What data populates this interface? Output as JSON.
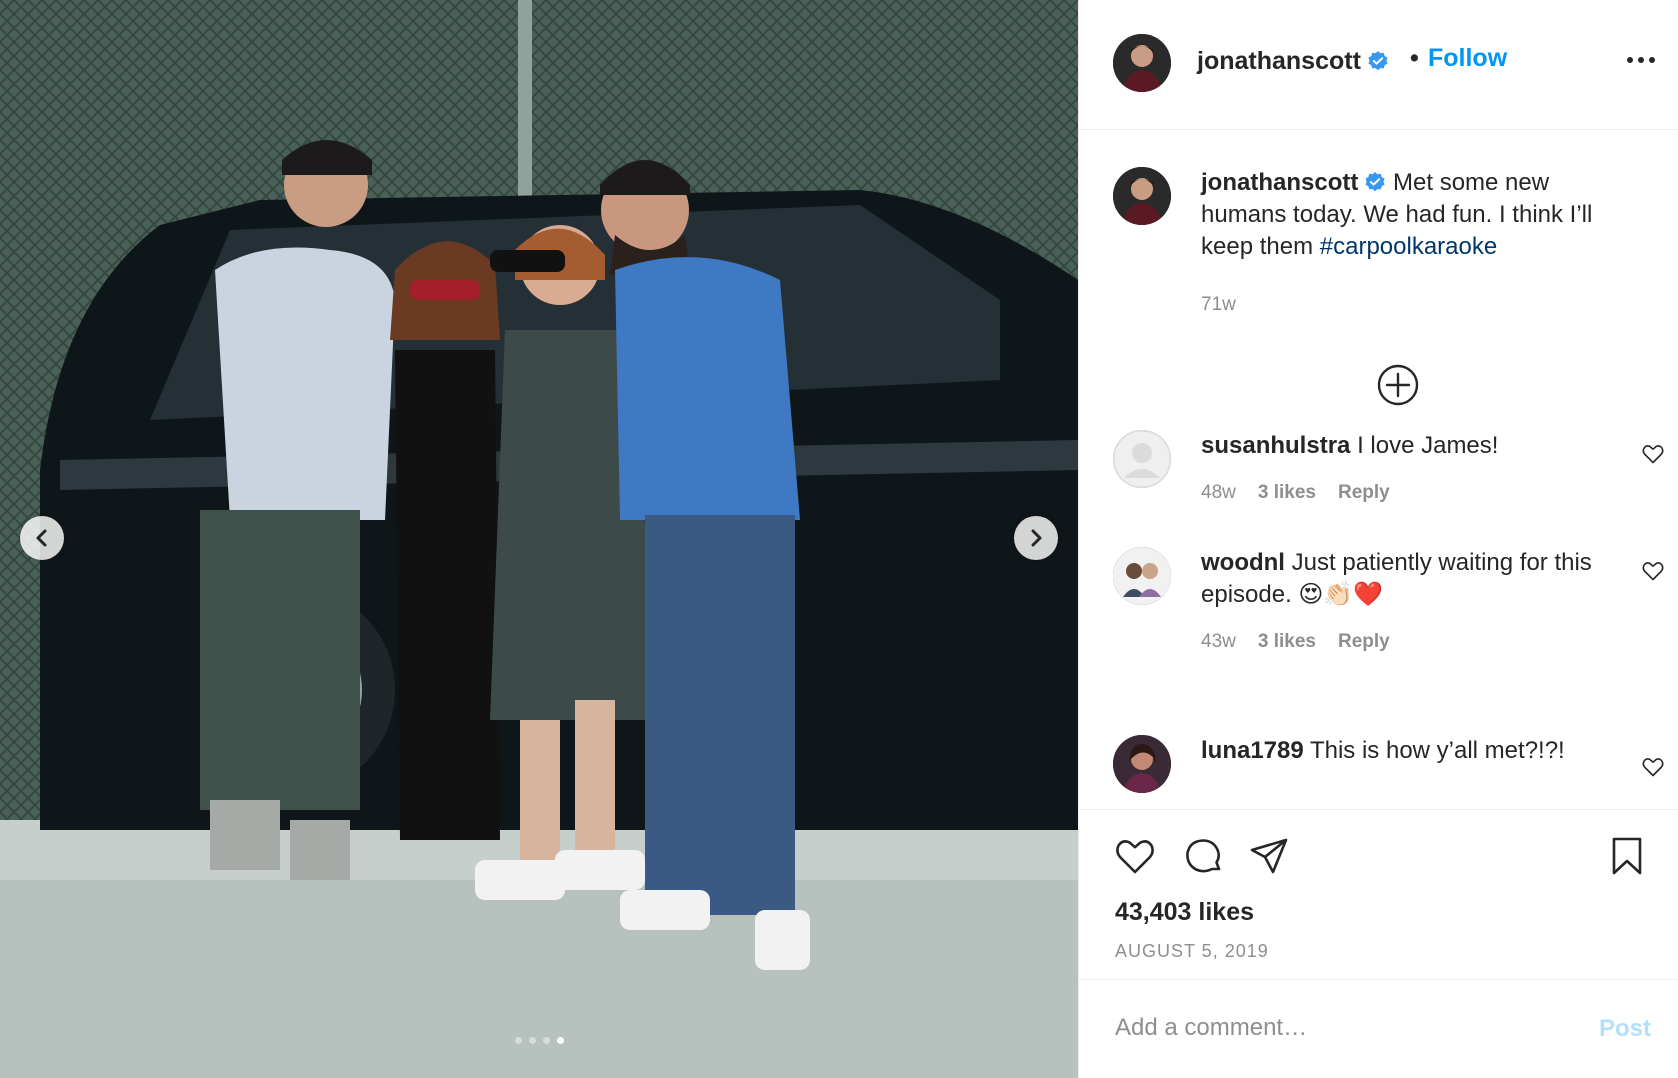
{
  "post": {
    "username": "jonathanscott",
    "separator": "•",
    "follow_label": "Follow",
    "more_icon": "more-options-icon",
    "verified_color": "#3897f0",
    "accent_color": "#0095f6"
  },
  "caption": {
    "username": "jonathanscott",
    "text": "Met some new humans today. We had fun. I think I’ll keep them",
    "hashtag": "#carpoolkaraoke",
    "time": "71w"
  },
  "comments": [
    {
      "username": "susanhulstra",
      "text": "I love James!",
      "time": "48w",
      "likes": "3 likes",
      "reply": "Reply"
    },
    {
      "username": "woodnl",
      "text": "Just patiently waiting for this episode. 😍👏🏻❤️",
      "time": "43w",
      "likes": "3 likes",
      "reply": "Reply"
    },
    {
      "username": "luna1789",
      "text": "This is how y’all met?!?!"
    }
  ],
  "likes_count": "43,403 likes",
  "date": "AUGUST 5, 2019",
  "comment_input": {
    "placeholder": "Add a comment…",
    "post_label": "Post"
  },
  "carousel": {
    "total": 4,
    "active_index": 4
  }
}
